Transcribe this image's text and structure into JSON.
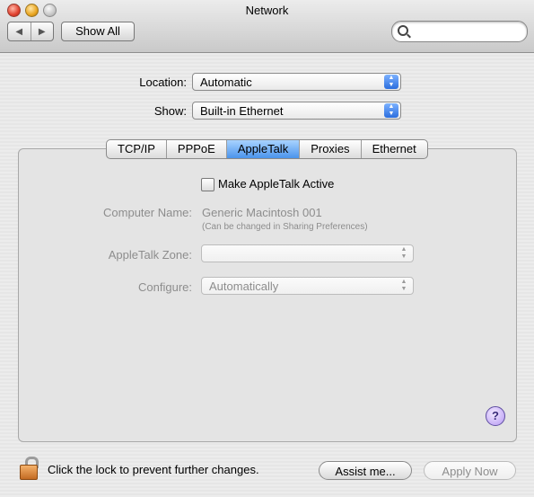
{
  "window": {
    "title": "Network"
  },
  "toolbar": {
    "back_glyph": "◀",
    "forward_glyph": "▶",
    "show_all_label": "Show All",
    "search_placeholder": ""
  },
  "location": {
    "label": "Location:",
    "value": "Automatic"
  },
  "show": {
    "label": "Show:",
    "value": "Built-in Ethernet"
  },
  "tabs": [
    {
      "label": "TCP/IP",
      "selected": false
    },
    {
      "label": "PPPoE",
      "selected": false
    },
    {
      "label": "AppleTalk",
      "selected": true
    },
    {
      "label": "Proxies",
      "selected": false
    },
    {
      "label": "Ethernet",
      "selected": false
    }
  ],
  "appletalk": {
    "make_active_label": "Make AppleTalk Active",
    "make_active_checked": false,
    "computer_name_label": "Computer Name:",
    "computer_name_value": "Generic Macintosh 001",
    "computer_name_hint": "(Can be changed in Sharing Preferences)",
    "zone_label": "AppleTalk Zone:",
    "zone_value": "",
    "configure_label": "Configure:",
    "configure_value": "Automatically"
  },
  "help_glyph": "?",
  "footer": {
    "lock_text": "Click the lock to prevent further changes.",
    "assist_label": "Assist me...",
    "apply_label": "Apply Now"
  },
  "colors": {
    "selected_tab": "#4b94ec",
    "popup_arrows": "#2b6ede",
    "lock_body": "#c36b23"
  }
}
